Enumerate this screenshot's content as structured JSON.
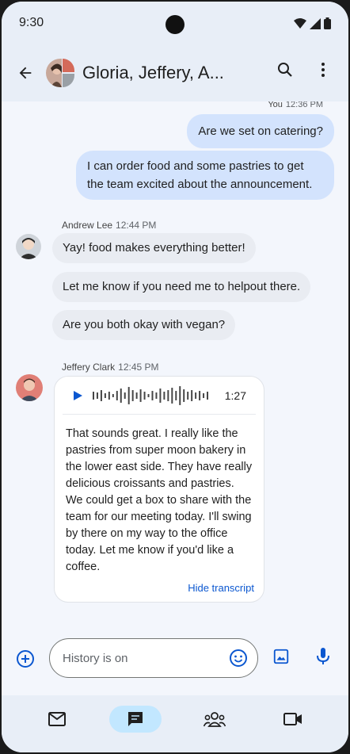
{
  "status_bar": {
    "time": "9:30"
  },
  "header": {
    "title": "Gloria, Jeffery, A..."
  },
  "messages": {
    "outgoing_meta": {
      "sender": "You",
      "time": "12:36 PM"
    },
    "outgoing": [
      "Are we set on catering?",
      "I can order food and some pastries to get the team excited about the announcement."
    ],
    "andrew": {
      "sender": "Andrew Lee",
      "time": "12:44 PM",
      "bubbles": [
        "Yay! food makes everything better!",
        "Let me know if you need me to helpout there.",
        "Are you both okay with vegan?"
      ]
    },
    "jeffery": {
      "sender": "Jeffery Clark",
      "time": "12:45 PM",
      "voice": {
        "duration": "1:27",
        "transcript": "That sounds great. I really like the pastries from super moon bakery in the lower east side. They have really delicious croissants and pastries. We could get a box to share with the team for our meeting today. I'll swing by there on my way to the office today. Let me know if you'd like a coffee.",
        "hide_label": "Hide transcript"
      }
    }
  },
  "compose": {
    "placeholder": "History is on"
  },
  "bottom_nav": {
    "items": [
      "mail",
      "chat",
      "spaces",
      "meet"
    ],
    "active": "chat"
  },
  "colors": {
    "accent": "#0b57d0",
    "outgoing_bubble": "#d3e3fd",
    "incoming_bubble": "#e9ecf2",
    "active_nav": "#c2e7ff"
  }
}
